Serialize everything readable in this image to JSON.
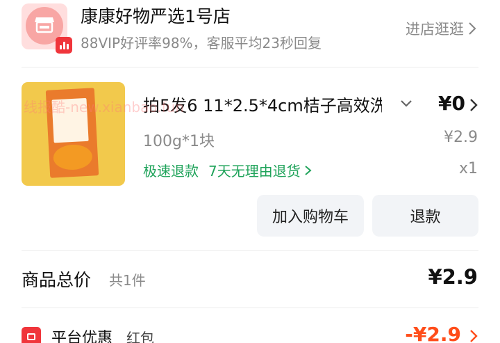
{
  "store": {
    "name": "康康好物严选1号店",
    "subtitle": "88VIP好评率98%，客服平均23秒回复",
    "link": "进店逛逛",
    "logo_icon": "storefront-icon",
    "badge_icon": "bar-chart-badge-icon"
  },
  "product": {
    "title": "拍5发6 11*2.5*4cm桔子高效洗",
    "price": "¥0",
    "spec": "100g*1块",
    "unit_price": "¥2.9",
    "quantity": "x1",
    "services": [
      "极速退款",
      "7天无理由退货"
    ],
    "image_icon": "orange-soap-package-image"
  },
  "actions": {
    "add_to_cart": "加入购物车",
    "refund": "退款"
  },
  "summary": {
    "total_label": "商品总价",
    "total_count": "共1件",
    "total_price": "¥2.9"
  },
  "promo": {
    "label": "平台优惠",
    "tag": "红包",
    "amount": "-¥2.9"
  },
  "watermark": "线报酷-new.xianbao.fun",
  "colors": {
    "accent_red": "#f0353b",
    "service_green": "#1fa35a",
    "discount_orange": "#ff4d1a",
    "button_bg": "#f2f4f7"
  }
}
